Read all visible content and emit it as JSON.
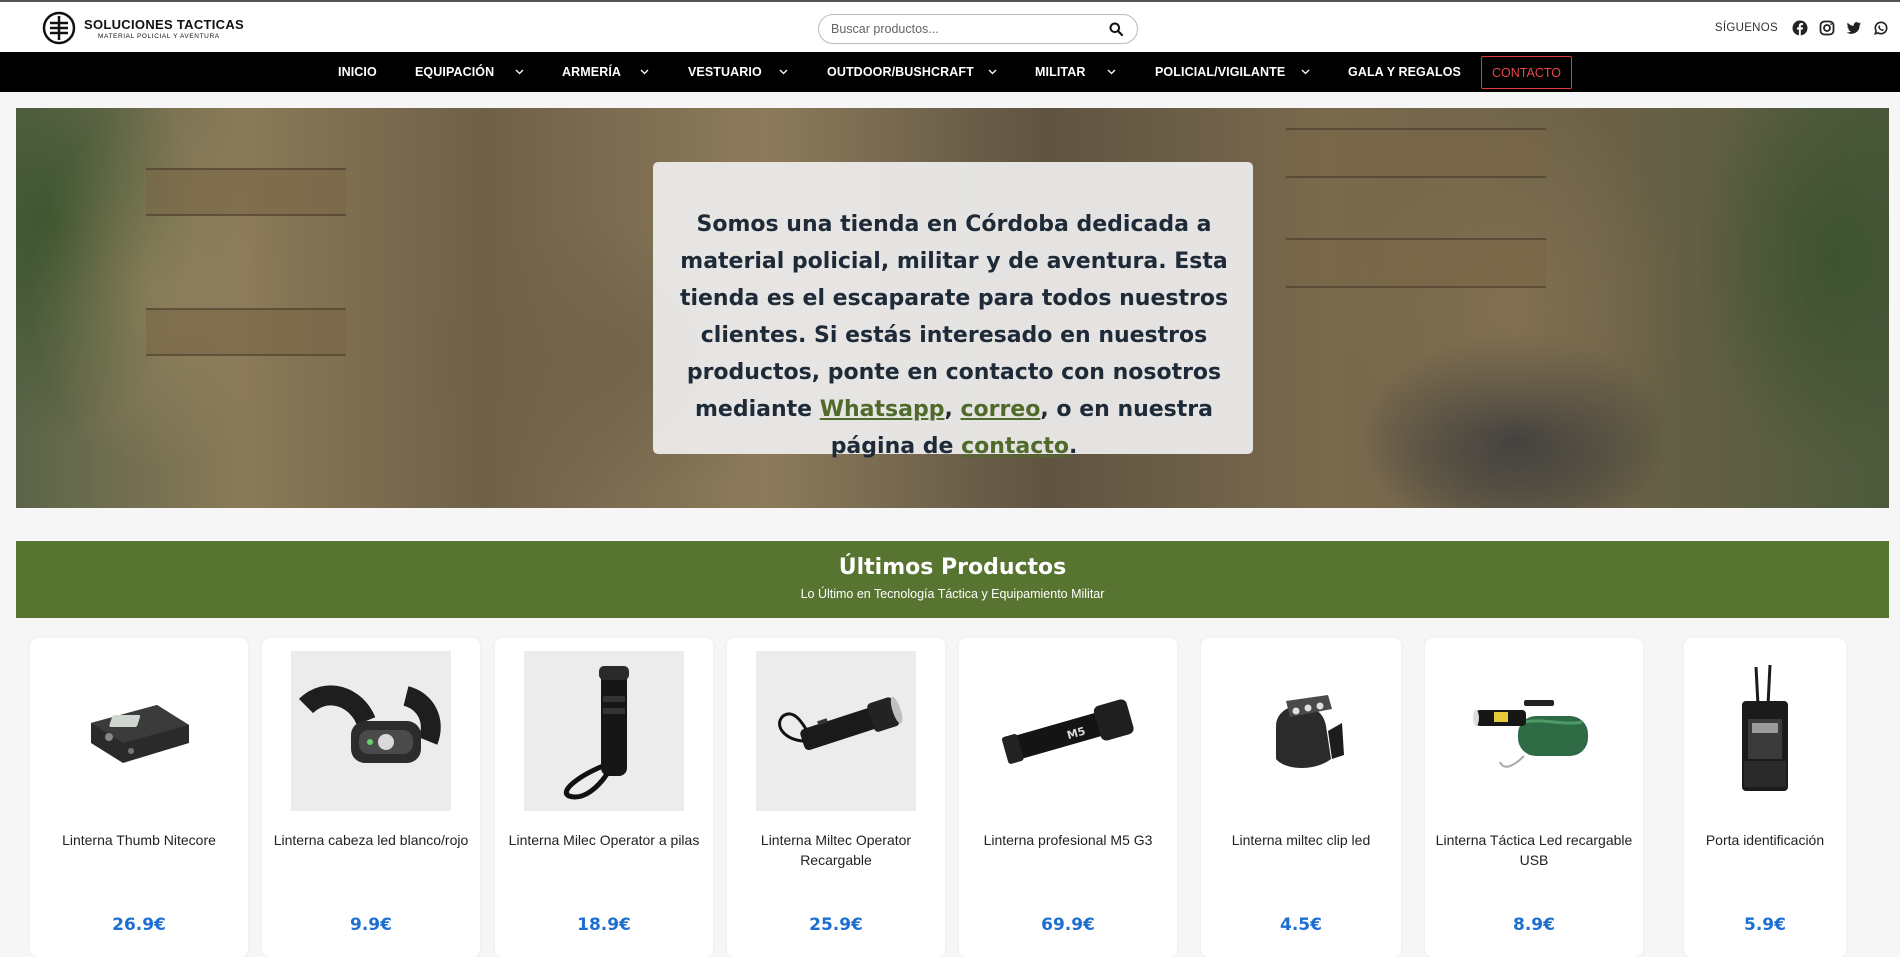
{
  "header": {
    "logo_title": "SOLUCIONES TACTICAS",
    "logo_subtitle": "MATERIAL POLICIAL Y AVENTURA",
    "search_placeholder": "Buscar productos...",
    "social_label": "SÍGUENOS",
    "social_icons": [
      "facebook-icon",
      "instagram-icon",
      "twitter-icon",
      "whatsapp-icon"
    ]
  },
  "nav": {
    "items": [
      {
        "label": "INICIO",
        "has_dropdown": false
      },
      {
        "label": "EQUIPACIÓN",
        "has_dropdown": true
      },
      {
        "label": "ARMERÍA",
        "has_dropdown": true
      },
      {
        "label": "VESTUARIO",
        "has_dropdown": true
      },
      {
        "label": "OUTDOOR/BUSHCRAFT",
        "has_dropdown": true
      },
      {
        "label": "MILITAR",
        "has_dropdown": true
      },
      {
        "label": "POLICIAL/VIGILANTE",
        "has_dropdown": true
      },
      {
        "label": "GALA Y REGALOS",
        "has_dropdown": false
      }
    ],
    "contact_label": "CONTACTO"
  },
  "hero": {
    "text_before": "Somos una tienda en Córdoba dedicada a material policial, militar y de aventura. Esta tienda es el escaparate para todos nuestros clientes. Si estás interesado en nuestros productos, ponte en contacto con nosotros mediante ",
    "link_whatsapp": "Whatsapp",
    "sep1": ", ",
    "link_correo": "correo",
    "sep2": ", o en nuestra página de ",
    "link_contacto": "contacto",
    "end": "."
  },
  "latest": {
    "title": "Últimos Productos",
    "subtitle": "Lo Último en Tecnología Táctica y Equipamiento Militar"
  },
  "products": [
    {
      "name": "Linterna Thumb Nitecore",
      "price": "26.9€"
    },
    {
      "name": "Linterna cabeza led blanco/rojo",
      "price": "9.9€"
    },
    {
      "name": "Linterna Milec Operator a pilas",
      "price": "18.9€"
    },
    {
      "name": "Linterna Miltec Operator Recargable",
      "price": "25.9€"
    },
    {
      "name": "Linterna profesional M5 G3",
      "price": "69.9€"
    },
    {
      "name": "Linterna miltec clip led",
      "price": "4.5€"
    },
    {
      "name": "Linterna Táctica Led recargable USB",
      "price": "8.9€"
    },
    {
      "name": "Porta identificación",
      "price": "5.9€"
    }
  ],
  "colors": {
    "accent_green": "#577431",
    "link_green": "#4f6a2a",
    "price_blue": "#1c6fd1",
    "contact_red": "#e03a3e",
    "nav_bg": "#000000"
  }
}
